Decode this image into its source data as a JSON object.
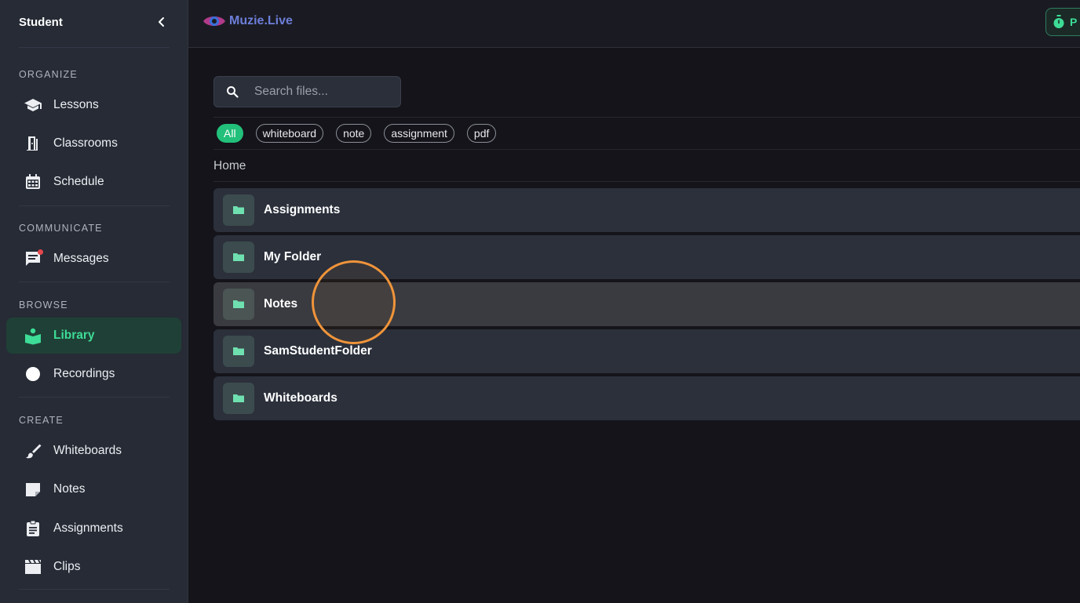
{
  "sidebar": {
    "title": "Student",
    "sections": {
      "organize": "ORGANIZE",
      "communicate": "COMMUNICATE",
      "browse": "BROWSE",
      "create": "CREATE"
    },
    "items": {
      "lessons": "Lessons",
      "classrooms": "Classrooms",
      "schedule": "Schedule",
      "messages": "Messages",
      "library": "Library",
      "recordings": "Recordings",
      "whiteboards": "Whiteboards",
      "notes": "Notes",
      "assignments": "Assignments",
      "clips": "Clips"
    },
    "active_item": "Library",
    "messages_has_notification": true
  },
  "topbar": {
    "logo_text": "Muzie.Live",
    "action_label": "P"
  },
  "main": {
    "search_placeholder": "Search files...",
    "filters": [
      "All",
      "whiteboard",
      "note",
      "assignment",
      "pdf"
    ],
    "active_filter": "All",
    "breadcrumb": "Home",
    "folders": [
      "Assignments",
      "My Folder",
      "Notes",
      "SamStudentFolder",
      "Whiteboards"
    ],
    "hovered_folder": "Notes"
  },
  "colors": {
    "accent": "#3ddc97",
    "chip_active": "#22c07a",
    "sidebar_bg": "#262b35",
    "main_bg": "#14141a",
    "folder_row_bg": "#2b303b",
    "cursor_ring": "#f0943a"
  }
}
